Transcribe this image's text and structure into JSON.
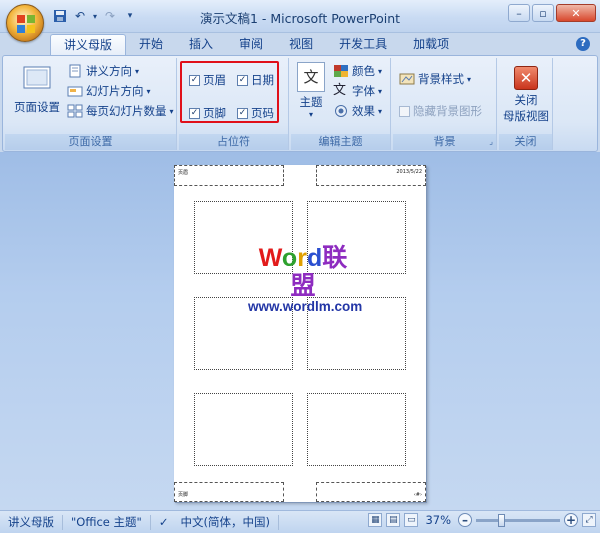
{
  "title_bar": {
    "title": "演示文稿1 - Microsoft PowerPoint",
    "quick_access": [
      "save-icon",
      "undo-icon",
      "redo-icon",
      "customize-icon"
    ]
  },
  "tabs": [
    {
      "label": "讲义母版",
      "active": true
    },
    {
      "label": "开始"
    },
    {
      "label": "插入"
    },
    {
      "label": "审阅"
    },
    {
      "label": "视图"
    },
    {
      "label": "开发工具"
    },
    {
      "label": "加载项"
    }
  ],
  "ribbon": {
    "page_setup": {
      "label": "页面设置",
      "big_button": "页面设置",
      "handout_orientation": "讲义方向",
      "slide_orientation": "幻灯片方向",
      "slides_per_page": "每页幻灯片数量"
    },
    "placeholders": {
      "label": "占位符",
      "header": "页眉",
      "date": "日期",
      "footer": "页脚",
      "page_number": "页码"
    },
    "edit_theme": {
      "label": "编辑主题",
      "theme": "主题",
      "theme_icon_text": "文",
      "colors": "颜色",
      "fonts": "字体",
      "fonts_icon_text": "文",
      "effects": "效果"
    },
    "background": {
      "label": "背景",
      "styles": "背景样式",
      "hide_graphics": "隐藏背景图形"
    },
    "close": {
      "label": "关闭",
      "button_line1": "关闭",
      "button_line2": "母版视图"
    }
  },
  "handout_page": {
    "header_text": "页眉",
    "date_text": "2013/5/22",
    "footer_text": "页脚",
    "page_number_text": "‹#›"
  },
  "watermark": {
    "title_letters": [
      {
        "ch": "W",
        "color": "#e21b1b"
      },
      {
        "ch": "o",
        "color": "#2ea12e"
      },
      {
        "ch": "r",
        "color": "#e0a000"
      },
      {
        "ch": "d",
        "color": "#2b4fd0"
      },
      {
        "ch": "联",
        "color": "#8e2cc0"
      },
      {
        "ch": "盟",
        "color": "#8e2cc0"
      }
    ],
    "url": "www.wordlm.com"
  },
  "status_bar": {
    "view_name": "讲义母版",
    "theme": "\"Office 主题\"",
    "language": "中文(简体，中国)",
    "zoom": "37%",
    "zoom_level": 0.37
  },
  "colors": {
    "accent": "#15428b",
    "highlight_box": "#e0101a",
    "close_red": "#d8472c"
  }
}
